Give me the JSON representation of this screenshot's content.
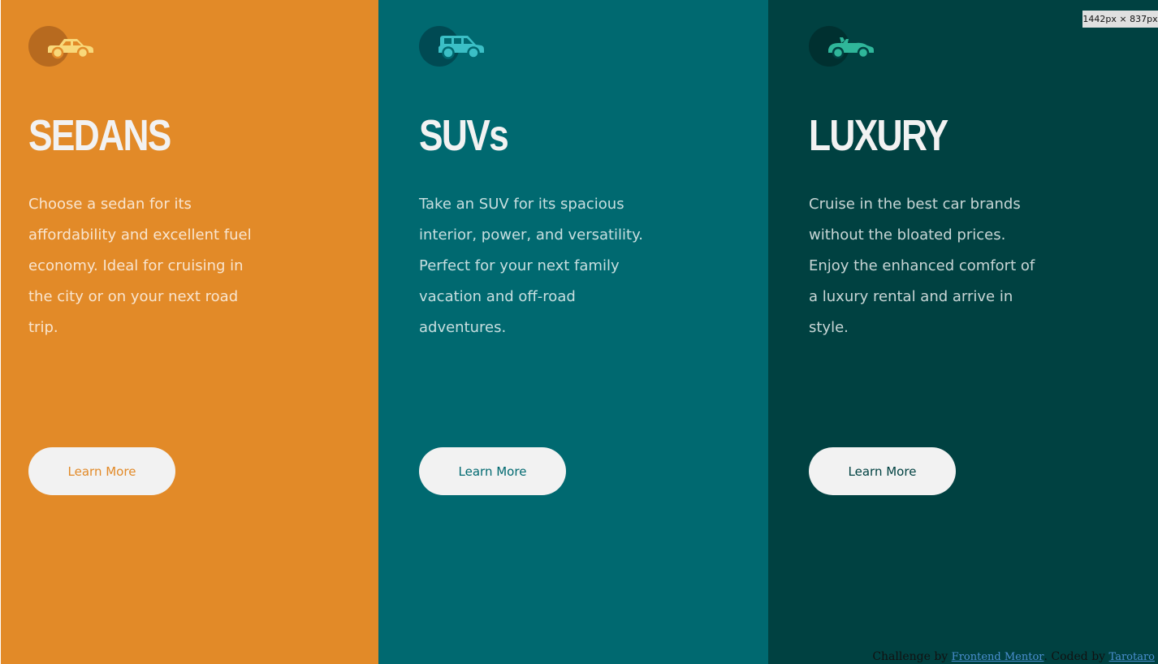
{
  "cards": [
    {
      "id": "sedans",
      "icon": "sedan-car-icon",
      "title": "SEDANS",
      "description": "Choose a sedan for its affordability and excellent fuel economy. Ideal for cruising in the city or on your next road trip.",
      "button_label": "Learn More",
      "background_color": "#e28a28",
      "icon_color": "#f8d87a"
    },
    {
      "id": "suvs",
      "icon": "suv-car-icon",
      "title": "SUVs",
      "description": "Take an SUV for its spacious interior, power, and versatility. Perfect for your next family vacation and off-road adventures.",
      "button_label": "Learn More",
      "background_color": "#006970",
      "icon_color": "#3bbfc6"
    },
    {
      "id": "luxury",
      "icon": "luxury-convertible-car-icon",
      "title": "LUXURY",
      "description": "Cruise in the best car brands without the bloated prices. Enjoy the enhanced comfort of a luxury rental and arrive in style.",
      "button_label": "Learn More",
      "background_color": "#004141",
      "icon_color": "#2fb69a"
    }
  ],
  "attribution": {
    "prefix": "Challenge by",
    "challenge_link": "Frontend Mentor",
    "separator": ". Coded by",
    "author_link": "Tarotaro"
  },
  "viewport_badge": "1442px × 837px"
}
